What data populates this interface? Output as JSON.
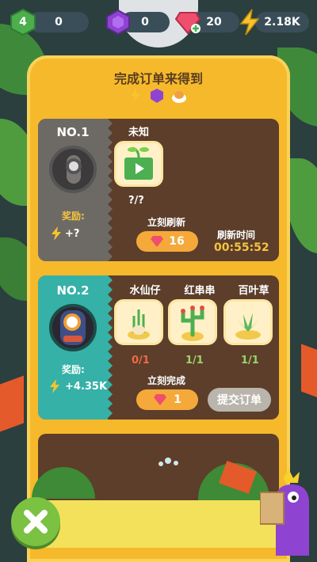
{
  "resources": {
    "level": "4",
    "level_value": "0",
    "purple_gems": "0",
    "red_gems": "20",
    "energy": "2.18K"
  },
  "panel": {
    "title": "完成订单来得到",
    "reward_icons": [
      "lightning-icon",
      "purple-gem-icon",
      "pudding-icon"
    ]
  },
  "order1": {
    "number": "NO.1",
    "reward_label": "奖励:",
    "reward_value": "+?",
    "item_name": "未知",
    "item_count": "?/?",
    "refresh_label": "立刻刷新",
    "refresh_cost": "16",
    "time_label": "刷新时间",
    "time_value": "00:55:52"
  },
  "order2": {
    "number": "NO.2",
    "reward_label": "奖励:",
    "reward_value": "+4.35K",
    "items": [
      {
        "name": "水仙仔",
        "count": "0/1"
      },
      {
        "name": "红串串",
        "count": "1/1"
      },
      {
        "name": "百叶草",
        "count": "1/1"
      }
    ],
    "complete_label": "立刻完成",
    "complete_cost": "1",
    "submit_label": "提交订单"
  },
  "colors": {
    "panel": "#f5b92b",
    "card": "#5c3e2a",
    "order1_left": "#6d6a66",
    "order2_left": "#35b1a7",
    "label": "#f5c441",
    "count_red": "#f06a4a",
    "count_green": "#9ad66a",
    "time": "#f5c441"
  }
}
